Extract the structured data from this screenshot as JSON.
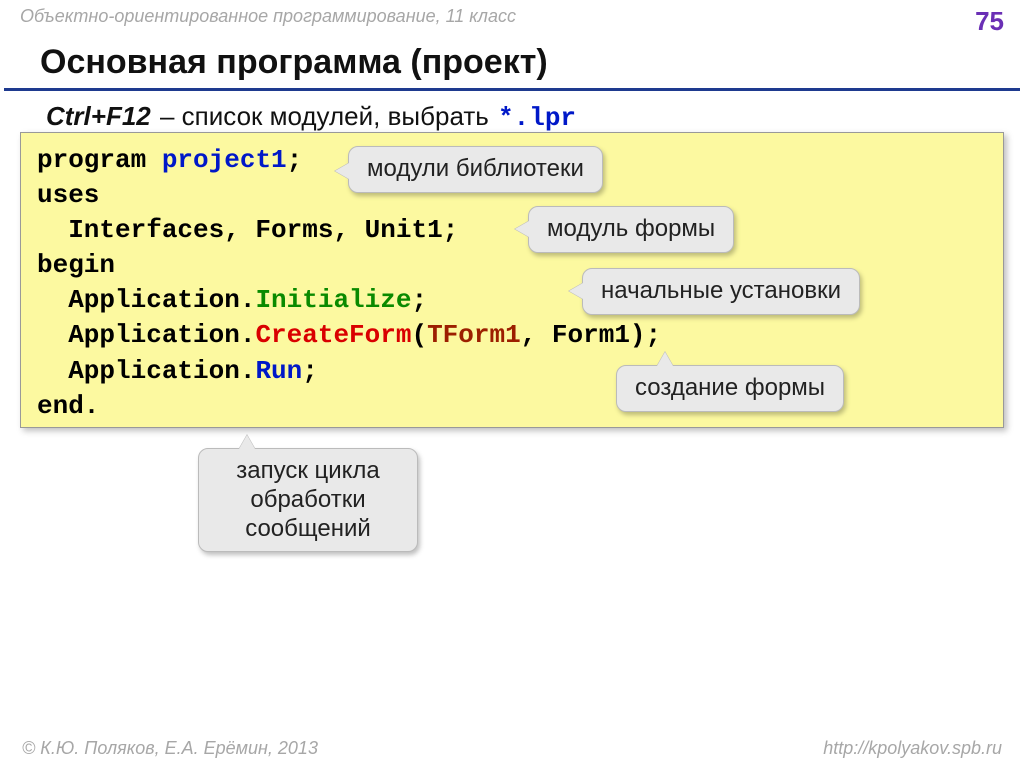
{
  "header": {
    "course": "Объектно-ориентированное программирование, 11 класс",
    "pagenum": "75"
  },
  "title": "Основная программа (проект)",
  "subtitle": {
    "hotkey": "Ctrl+F12",
    "rest": " – список модулей, выбрать ",
    "lpr": "*.lpr"
  },
  "code": {
    "l1a": "program ",
    "l1b": "project1",
    "l1c": ";",
    "l2": "uses",
    "l3": "  Interfaces, Forms, Unit1;",
    "l4": "begin",
    "l5a": "  Application.",
    "l5b": "Initialize",
    "l5c": ";",
    "l6a": "  Application.",
    "l6b": "CreateForm",
    "l6c": "(",
    "l6d": "TForm1",
    "l6e": ", Form1);",
    "l7a": "  Application.",
    "l7b": "Run",
    "l7c": ";",
    "l8": "end."
  },
  "callouts": {
    "c1": "модули библиотеки",
    "c2": "модуль формы",
    "c3": "начальные установки",
    "c4": "создание формы",
    "c5": "запуск цикла обработки сообщений"
  },
  "footer": {
    "left": "© К.Ю. Поляков, Е.А. Ерёмин, 2013",
    "right": "http://kpolyakov.spb.ru"
  }
}
